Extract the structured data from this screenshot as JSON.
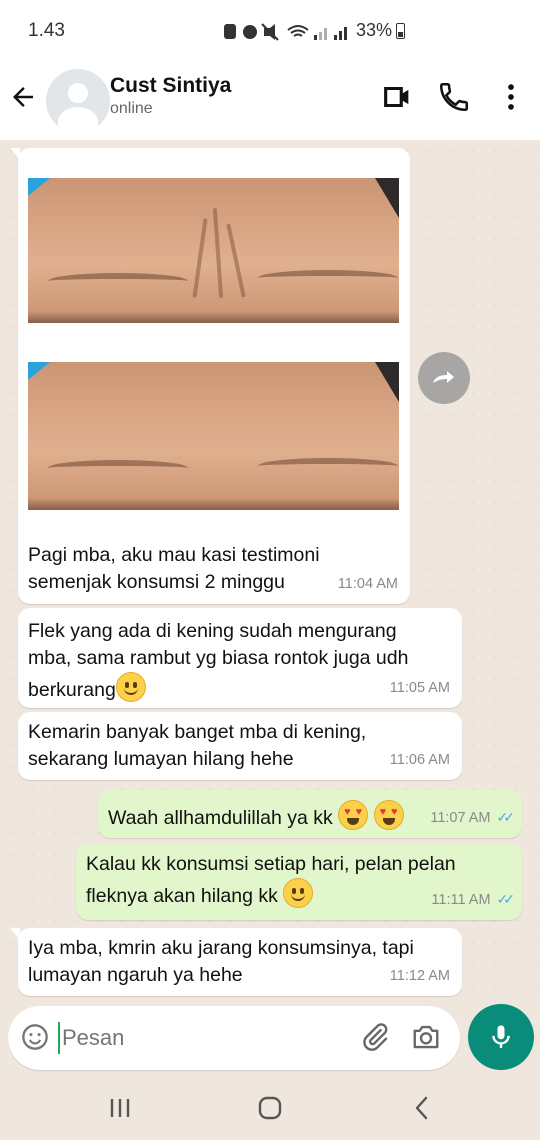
{
  "status_bar": {
    "time": "1.43",
    "battery": "33%"
  },
  "header": {
    "contact_name": "Cust Sintiya",
    "contact_status": "online"
  },
  "messages": [
    {
      "type": "in-image",
      "text_line1": "Pagi mba, aku mau kasi testimoni",
      "text_line2": "semenjak konsumsi 2 minggu",
      "time": "11:04 AM"
    },
    {
      "type": "in",
      "line1": "Flek yang ada di kening sudah mengurang",
      "line2": "mba, sama rambut yg biasa rontok juga udh",
      "line3": "berkurang",
      "emoji": "slightly-smiling-face",
      "time": "11:05 AM"
    },
    {
      "type": "in",
      "line1": "Kemarin banyak banget mba di kening,",
      "line2": "sekarang lumayan hilang hehe",
      "time": "11:06 AM"
    },
    {
      "type": "out",
      "line1": "Waah allhamdulillah ya kk",
      "emoji": "heart-eyes x2",
      "time": "11:07 AM",
      "status": "read"
    },
    {
      "type": "out",
      "line1": "Kalau kk konsumsi setiap hari, pelan pelan",
      "line2": "fleknya akan hilang kk",
      "emoji": "slightly-smiling-face",
      "time": "11:11 AM",
      "status": "read"
    },
    {
      "type": "in",
      "line1": "Iya mba, kmrin aku jarang konsumsinya, tapi",
      "line2": "lumayan ngaruh ya hehe",
      "time": "11:12 AM"
    }
  ],
  "input": {
    "placeholder": "Pesan"
  },
  "icons": {
    "back": "arrow-left-icon",
    "video": "video-call-icon",
    "call": "phone-icon",
    "menu": "more-vert-icon",
    "forward": "forward-icon",
    "emoji": "emoji-icon",
    "attach": "paperclip-icon",
    "camera": "camera-icon",
    "mic": "mic-icon"
  },
  "colors": {
    "accent": "#0a8c7a",
    "outgoing_bubble": "#e1f6cb",
    "read_ticks": "#4fa8e0",
    "chat_background": "#efe7dd"
  }
}
